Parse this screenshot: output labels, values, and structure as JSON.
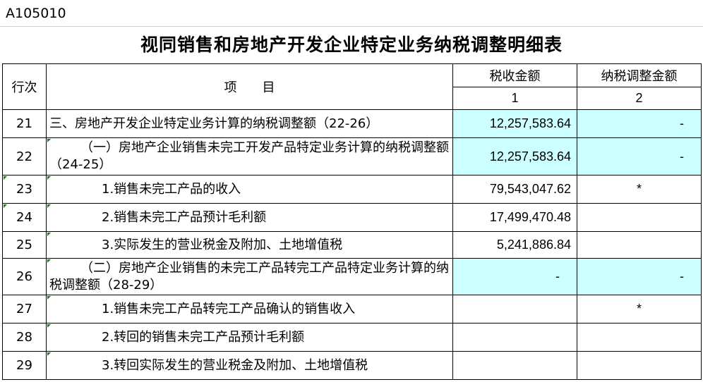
{
  "form_code": "A105010",
  "title": "视同销售和房地产开发企业特定业务纳税调整明细表",
  "header": {
    "row_no": "行次",
    "item": "项　　目",
    "col1_label": "税收金额",
    "col2_label": "纳税调整金额",
    "col1_no": "1",
    "col2_no": "2"
  },
  "colors": {
    "highlight": "#ccffff",
    "border": "#000000"
  },
  "rows": [
    {
      "no": "21",
      "desc": "三、房地产开发企业特定业务计算的纳税调整额（22-26）",
      "col1": "12,257,583.64",
      "col2": "-"
    },
    {
      "no": "22",
      "desc": "（一）房地产企业销售未完工开发产品特定业务计算的纳税调整额（24-25）",
      "col1": "12,257,583.64",
      "col2": "-"
    },
    {
      "no": "23",
      "desc": "1.销售未完工产品的收入",
      "col1": "79,543,047.62",
      "col2": "*"
    },
    {
      "no": "24",
      "desc": "2.销售未完工产品预计毛利额",
      "col1": "17,499,470.48",
      "col2": ""
    },
    {
      "no": "25",
      "desc": "3.实际发生的营业税金及附加、土地增值税",
      "col1": "5,241,886.84",
      "col2": ""
    },
    {
      "no": "26",
      "desc": "（二）房地产企业销售的未完工产品转完工产品特定业务计算的纳税调整额（28-29）",
      "col1": "-",
      "col2": "-"
    },
    {
      "no": "27",
      "desc": "1.销售未完工产品转完工产品确认的销售收入",
      "col1": "",
      "col2": "*"
    },
    {
      "no": "28",
      "desc": "2.转回的销售未完工产品预计毛利额",
      "col1": "",
      "col2": ""
    },
    {
      "no": "29",
      "desc": "3.转回实际发生的营业税金及附加、土地增值税",
      "col1": "",
      "col2": ""
    }
  ]
}
